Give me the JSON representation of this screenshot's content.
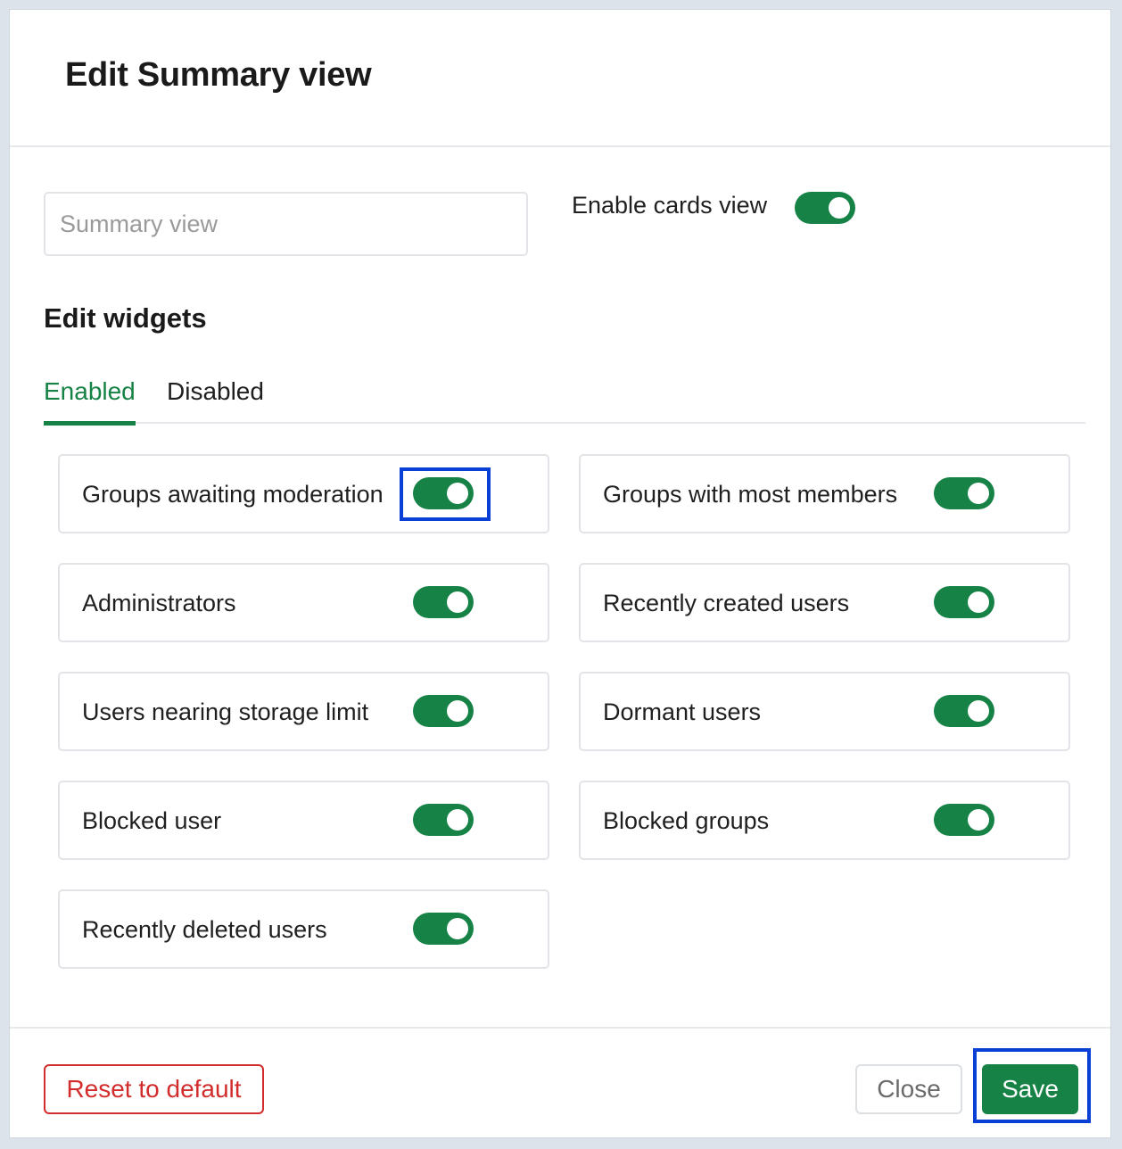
{
  "dialog": {
    "title": "Edit Summary view"
  },
  "view_name": {
    "placeholder": "Summary view",
    "value": ""
  },
  "cards_view": {
    "label": "Enable cards view",
    "enabled": true
  },
  "widgets_section": {
    "title": "Edit widgets",
    "tabs": [
      {
        "label": "Enabled",
        "active": true
      },
      {
        "label": "Disabled",
        "active": false
      }
    ],
    "widgets": [
      {
        "label": "Groups awaiting moderation",
        "enabled": true
      },
      {
        "label": "Groups with most members",
        "enabled": true
      },
      {
        "label": "Administrators",
        "enabled": true
      },
      {
        "label": "Recently created users",
        "enabled": true
      },
      {
        "label": "Users nearing storage limit",
        "enabled": true
      },
      {
        "label": "Dormant users",
        "enabled": true
      },
      {
        "label": "Blocked user",
        "enabled": true
      },
      {
        "label": "Blocked groups",
        "enabled": true
      },
      {
        "label": "Recently deleted users",
        "enabled": true
      }
    ]
  },
  "footer": {
    "reset_label": "Reset to default",
    "close_label": "Close",
    "save_label": "Save"
  },
  "colors": {
    "accent": "#168245",
    "danger": "#d22c2c",
    "focus": "#0a3fd6"
  }
}
